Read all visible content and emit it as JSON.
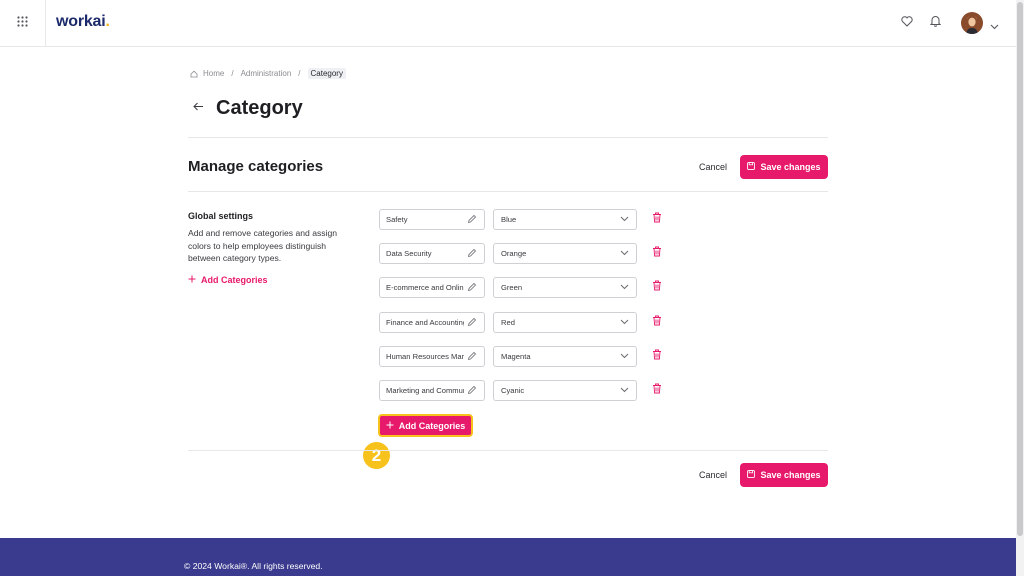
{
  "header": {
    "logo_text": "workai",
    "logo_dot": ".",
    "accent": "#e7196a",
    "logo_color": "#1c2a6b",
    "icons": [
      "grid-icon",
      "heart-icon",
      "bell-icon",
      "chevron-down-icon"
    ]
  },
  "breadcrumb": {
    "items": [
      "Home",
      "Administration",
      "Category"
    ]
  },
  "page": {
    "title": "Category"
  },
  "section": {
    "title": "Manage categories",
    "cancel_label": "Cancel",
    "save_label": "Save changes"
  },
  "global_settings": {
    "title": "Global settings",
    "description": "Add and remove categories and assign colors to help employees distinguish between category types.",
    "add_label": "Add Categories"
  },
  "categories": [
    {
      "name": "Safety",
      "color": "Blue"
    },
    {
      "name": "Data Security",
      "color": "Orange"
    },
    {
      "name": "E-commerce and Online",
      "color": "Green"
    },
    {
      "name": "Finance and Accounting",
      "color": "Red"
    },
    {
      "name": "Human Resources Management",
      "color": "Magenta"
    },
    {
      "name": "Marketing and Communication",
      "color": "Cyanic"
    }
  ],
  "add_categories_button": {
    "label": "Add Categories"
  },
  "step_badge": "2",
  "footer": {
    "copyright": "© 2024 Workai®. All rights reserved.",
    "bg": "#3a3a8e"
  }
}
